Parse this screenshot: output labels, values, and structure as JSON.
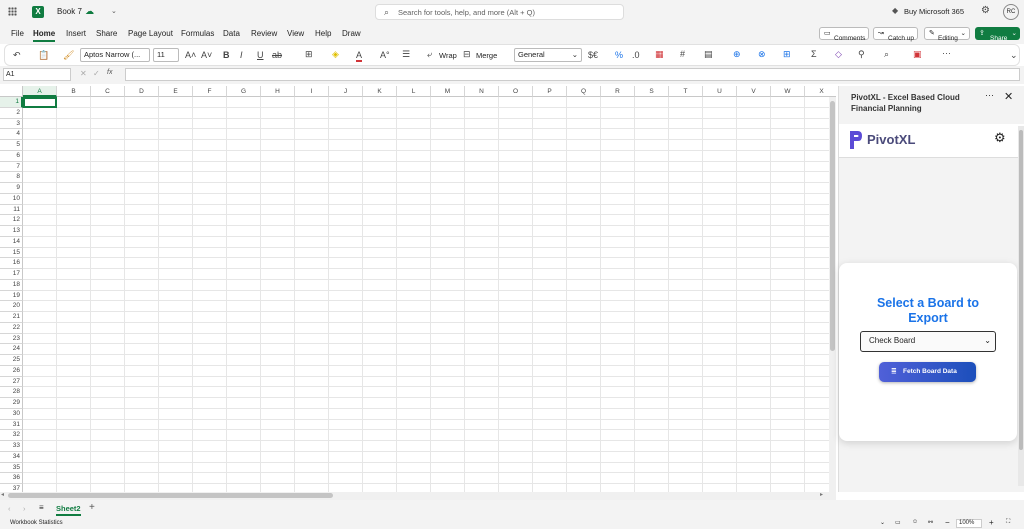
{
  "titlebar": {
    "workbook": "Book 7",
    "search_placeholder": "Search for tools, help, and more (Alt + Q)",
    "buy": "Buy Microsoft 365",
    "avatar": "RC"
  },
  "tabs": [
    "File",
    "Home",
    "Insert",
    "Share",
    "Page Layout",
    "Formulas",
    "Data",
    "Review",
    "View",
    "Help",
    "Draw"
  ],
  "tabs_right": {
    "comments": "Comments",
    "catchup": "Catch up",
    "editing": "Editing",
    "share": "Share"
  },
  "toolbar": {
    "font": "Aptos Narrow (...",
    "size": "11",
    "wrap": "Wrap",
    "merge": "Merge",
    "format": "General"
  },
  "formula": {
    "namebox": "A1",
    "fx": "fx"
  },
  "columns": [
    "A",
    "B",
    "C",
    "D",
    "E",
    "F",
    "G",
    "H",
    "I",
    "J",
    "K",
    "L",
    "M",
    "N",
    "O",
    "P",
    "Q",
    "R",
    "S",
    "T",
    "U",
    "V",
    "W",
    "X"
  ],
  "rows": [
    "1",
    "2",
    "3",
    "4",
    "5",
    "6",
    "7",
    "8",
    "9",
    "10",
    "11",
    "12",
    "13",
    "14",
    "15",
    "16",
    "17",
    "18",
    "19",
    "20",
    "21",
    "22",
    "23",
    "24",
    "25",
    "26",
    "27",
    "28",
    "29",
    "30",
    "31",
    "32",
    "33",
    "34",
    "35",
    "36",
    "37"
  ],
  "sheets": {
    "active": "Sheet2"
  },
  "status": {
    "left": "Workbook Statistics",
    "zoom": "100%"
  },
  "pane": {
    "title": "PivotXL - Excel Based Cloud Financial Planning",
    "logo": "PivotXL",
    "heading": "Select a Board to Export",
    "select_value": "Check Board",
    "button": "Fetch Board Data"
  },
  "colors": {
    "excel_green": "#107c41",
    "accent_blue": "#1a73e8",
    "button": "#3b5fd6"
  }
}
